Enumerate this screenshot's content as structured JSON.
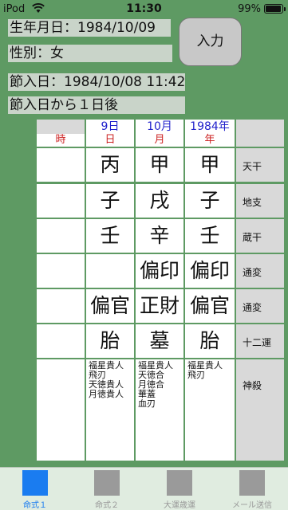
{
  "status": {
    "carrier": "iPod",
    "time": "11:30",
    "battery": "99%"
  },
  "birth_date": "生年月日：1984/10/09",
  "gender": "性別：女",
  "input_button": "入力",
  "setsuiri_date": "節入日：1984/10/08 11:42",
  "days_after": "節入日から１日後",
  "header": {
    "dates": [
      "",
      "9日",
      "10月",
      "1984年"
    ],
    "pillars": [
      "時",
      "日",
      "月",
      "年"
    ]
  },
  "rows": [
    {
      "label": "天干",
      "cells": [
        "",
        "丙",
        "甲",
        "甲"
      ]
    },
    {
      "label": "地支",
      "cells": [
        "",
        "子",
        "戌",
        "子"
      ]
    },
    {
      "label": "蔵干",
      "cells": [
        "",
        "壬",
        "辛",
        "壬"
      ]
    },
    {
      "label": "通変",
      "cells": [
        "",
        "",
        "偏印",
        "偏印"
      ]
    },
    {
      "label": "通変",
      "cells": [
        "",
        "偏官",
        "正財",
        "偏官"
      ]
    },
    {
      "label": "十二運",
      "cells": [
        "",
        "胎",
        "墓",
        "胎"
      ]
    }
  ],
  "shinsatsu": {
    "label": "神殺",
    "cells": [
      "",
      "福星貴人\n飛刃\n天徳貴人\n月徳貴人",
      "福星貴人\n天徳合\n月徳合\n華蓋\n血刃",
      "福星貴人\n飛刃"
    ]
  },
  "tabs": [
    {
      "label": "命式１",
      "active": true
    },
    {
      "label": "命式２",
      "active": false
    },
    {
      "label": "大運歳運",
      "active": false
    },
    {
      "label": "メール送信",
      "active": false
    }
  ]
}
